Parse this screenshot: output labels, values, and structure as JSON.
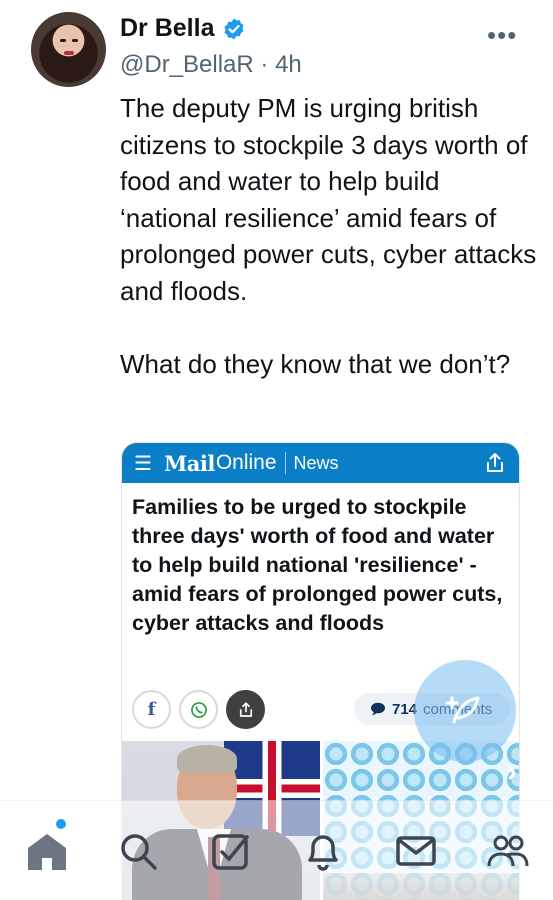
{
  "author": {
    "name": "Dr Bella",
    "handle": "@Dr_BellaR",
    "time_sep": "·",
    "time": "4h"
  },
  "more_menu": "•••",
  "tweet": {
    "text": "The deputy PM is urging british citizens to stockpile 3 days worth of food and water to help build ‘national resilience’ amid fears of prolonged power cuts, cyber attacks and floods.\n\nWhat do they know that we don’t?"
  },
  "card": {
    "brand_mail": "Mail",
    "brand_online": "Online",
    "section": "News",
    "headline": "Families to be urged to stockpile three days' worth of food and water to help build national 'resilience' - amid fears of prolonged power cuts, cyber attacks and floods",
    "facebook": "f",
    "comments_count": "714",
    "comments_label": "comments"
  },
  "colors": {
    "accent": "#1d9bf0",
    "mail_blue": "#0a7fc7",
    "text": "#0f1419",
    "muted": "#536471"
  },
  "icons": {
    "verified": "verified-badge-icon",
    "compose": "compose-icon",
    "tabs": [
      "home-icon",
      "search-icon",
      "grok-icon",
      "notifications-icon",
      "messages-icon",
      "communities-icon"
    ]
  }
}
